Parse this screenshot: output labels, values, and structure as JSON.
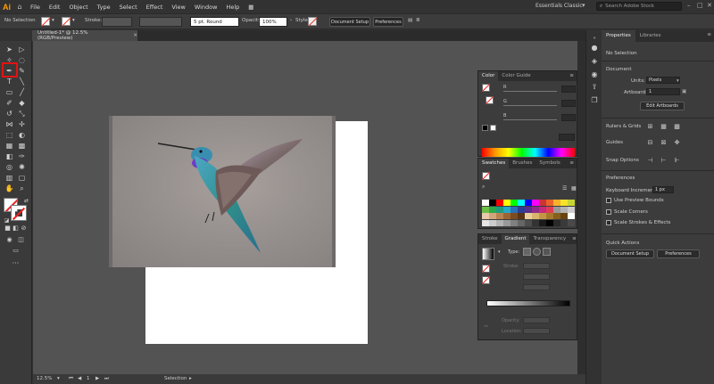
{
  "app": {
    "logo": "Ai",
    "menus": [
      "File",
      "Edit",
      "Object",
      "Type",
      "Select",
      "Effect",
      "View",
      "Window",
      "Help"
    ],
    "workspace": "Essentials Classic",
    "search_placeholder": "Search Adobe Stock",
    "window_controls": [
      "–",
      "□",
      "✕"
    ]
  },
  "control_bar": {
    "selection_label": "No Selection",
    "stroke_label": "Stroke:",
    "brush_value": "5 pt. Round",
    "opacity_label": "Opacity:",
    "opacity_value": "100%",
    "style_label": "Style:",
    "doc_setup_button": "Document Setup",
    "preferences_button": "Preferences"
  },
  "document": {
    "tab_label": "Untitled-1* @ 12.5% (RGB/Preview)",
    "close_glyph": "✕"
  },
  "status_bar": {
    "zoom": "12.5%",
    "page": "1",
    "tool": "Selection"
  },
  "color_panel": {
    "tabs": [
      "Color",
      "Color Guide"
    ],
    "channels": [
      "R",
      "G",
      "B"
    ]
  },
  "swatches_panel": {
    "tabs": [
      "Swatches",
      "Brushes",
      "Symbols"
    ],
    "colors": [
      "#ffffff",
      "#000000",
      "#ff0000",
      "#ffff00",
      "#00ff00",
      "#00ffff",
      "#0000ff",
      "#ff00ff",
      "#cc3333",
      "#e8632a",
      "#f7b22b",
      "#f4e32a",
      "#c5d634",
      "#6cbf45",
      "#2ea84a",
      "#1f9b7c",
      "#25a8c9",
      "#2b6fb6",
      "#2c3e92",
      "#5b2d8d",
      "#8e2c8b",
      "#c32a7c",
      "#e13b54",
      "#999999",
      "#b3b3b3",
      "#cccccc",
      "#e8c9a8",
      "#d4a57a",
      "#b9834f",
      "#9a6433",
      "#7b4b22",
      "#5a3416",
      "#ebcf9a",
      "#d8b56c",
      "#c39645",
      "#a5782c",
      "#865e1e",
      "#664414",
      "#ffffff",
      "#e6e6e6",
      "#cccccc",
      "#b3b3b3",
      "#999999",
      "#808080",
      "#666666",
      "#4d4d4d",
      "#333333",
      "#1a1a1a",
      "#000000",
      "#2a2a2a",
      "#3a3a3a",
      "#4a4a4a"
    ]
  },
  "gradient_panel": {
    "tabs": [
      "Stroke",
      "Gradient",
      "Transparency"
    ],
    "type_label": "Type:",
    "stroke_label": "Stroke:",
    "opacity_label": "Opacity:",
    "location_label": "Location:"
  },
  "properties": {
    "tabs": [
      "Properties",
      "Libraries"
    ],
    "selection": "No Selection",
    "document_heading": "Document",
    "units_label": "Units:",
    "units_value": "Pixels",
    "artboard_label": "Artboard:",
    "artboard_value": "1",
    "edit_artboards_button": "Edit Artboards",
    "rulers_label": "Rulers & Grids",
    "guides_label": "Guides",
    "snap_label": "Snap Options",
    "preferences_heading": "Preferences",
    "keyboard_increment_label": "Keyboard Increment:",
    "keyboard_increment_value": "1 px",
    "use_preview_bounds": "Use Preview Bounds",
    "scale_corners": "Scale Corners",
    "scale_strokes": "Scale Strokes & Effects",
    "quick_actions_heading": "Quick Actions",
    "doc_setup_button": "Document Setup",
    "preferences_button": "Preferences"
  }
}
